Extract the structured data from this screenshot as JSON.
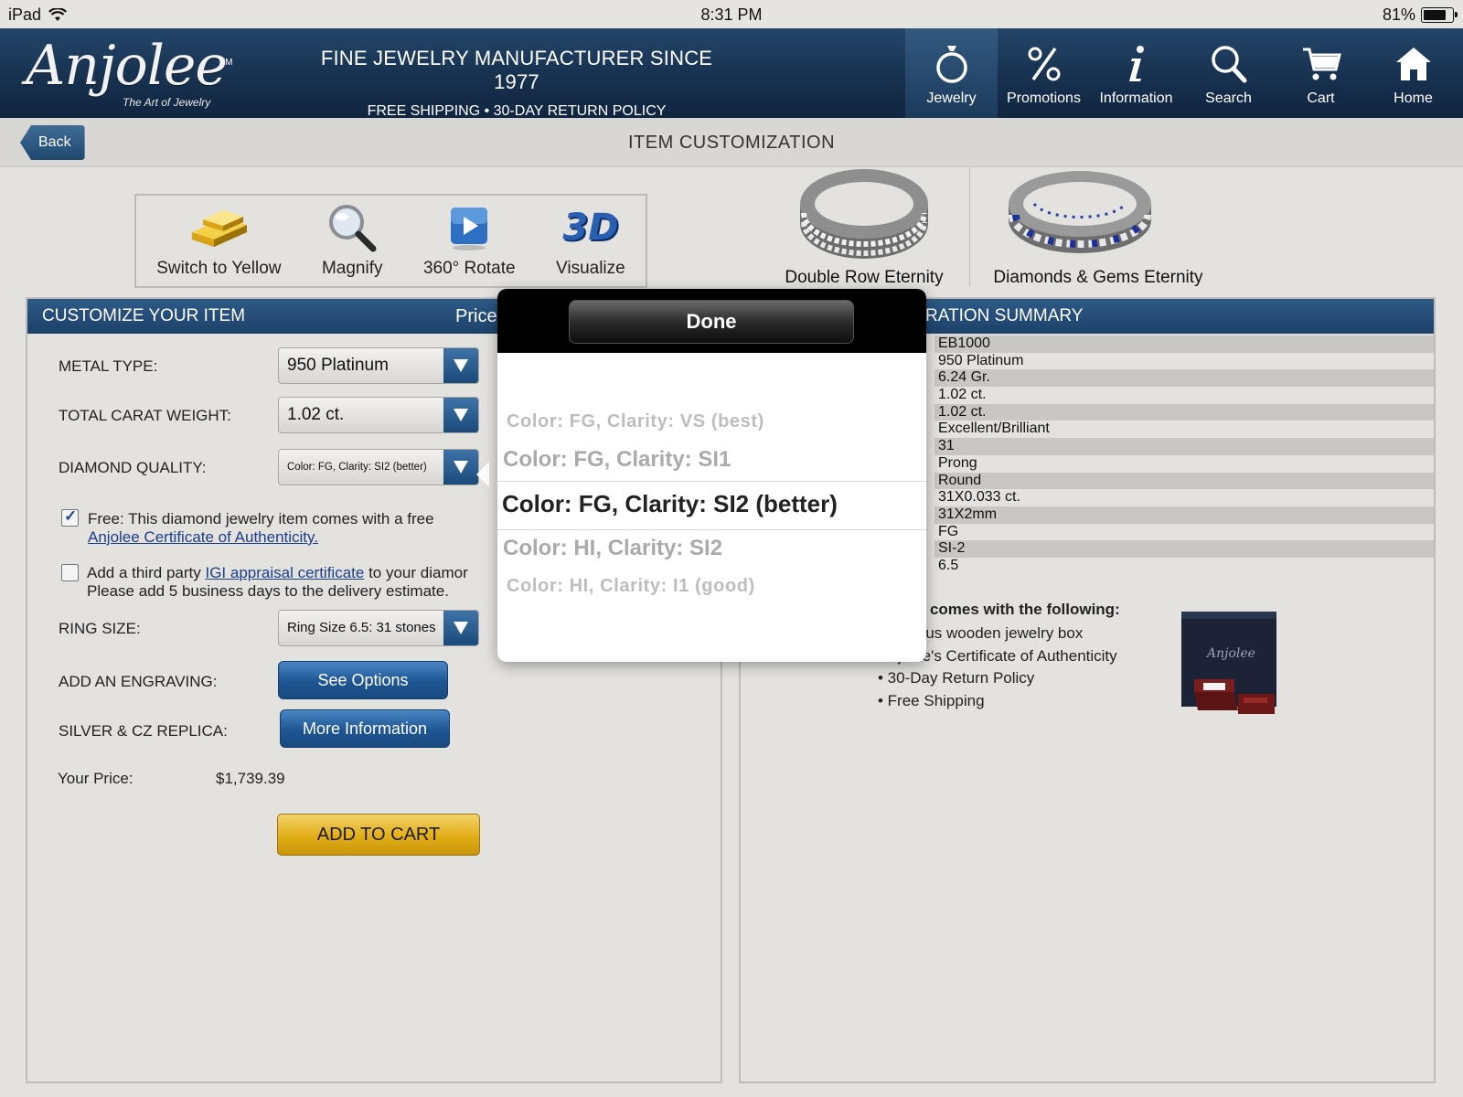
{
  "status": {
    "device": "iPad",
    "time": "8:31 PM",
    "battery": "81%",
    "battery_level": 0.81
  },
  "header": {
    "logo_text": "Anjolee",
    "logo_tm": "TM",
    "logo_tagline": "The Art of Jewelry",
    "tagline_main": "FINE JEWELRY MANUFACTURER SINCE 1977",
    "tagline_sub": "FREE SHIPPING  •  30-DAY RETURN POLICY",
    "nav": [
      {
        "label": "Jewelry",
        "icon": "ring-icon",
        "active": true
      },
      {
        "label": "Promotions",
        "icon": "percent-icon"
      },
      {
        "label": "Information",
        "icon": "info-icon"
      },
      {
        "label": "Search",
        "icon": "search-icon"
      },
      {
        "label": "Cart",
        "icon": "cart-icon"
      },
      {
        "label": "Home",
        "icon": "home-icon"
      }
    ]
  },
  "titlebar": {
    "back_label": "Back",
    "title": "ITEM CUSTOMIZATION"
  },
  "tools": [
    {
      "label": "Switch to Yellow",
      "icon": "gold-bars-icon"
    },
    {
      "label": "Magnify",
      "icon": "magnifier-icon"
    },
    {
      "label": "360° Rotate",
      "icon": "play-icon"
    },
    {
      "label": "Visualize",
      "icon": "3d-icon",
      "icon_text": "3D"
    }
  ],
  "thumbs": [
    {
      "label": "Double Row Eternity"
    },
    {
      "label": "Diamonds & Gems Eternity"
    }
  ],
  "customize": {
    "heading": "CUSTOMIZE YOUR ITEM",
    "price_label": "Price",
    "metal_label": "METAL TYPE:",
    "metal_value": "950 Platinum",
    "carat_label": "TOTAL CARAT WEIGHT:",
    "carat_value": "1.02 ct.",
    "quality_label": "DIAMOND QUALITY:",
    "quality_value": "Color: FG, Clarity: SI2 (better)",
    "cert_text": "Free: This diamond jewelry item comes with a free",
    "cert_link": "Anjolee Certificate of  Authenticity.",
    "igi_text_1": "Add a third party",
    "igi_link": "IGI appraisal certificate",
    "igi_text_2": " to your diamor",
    "igi_text_3": "Please add 5 business days to the delivery estimate.",
    "ring_label": "RING SIZE:",
    "ring_value": "Ring Size 6.5: 31 stones",
    "engraving_label": "ADD AN ENGRAVING:",
    "engraving_button": "See Options",
    "replica_label": "SILVER & CZ REPLICA:",
    "replica_button": "More Information",
    "your_price_label": "Your Price:",
    "your_price_value": "$1,739.39",
    "add_to_cart": "ADD TO CART"
  },
  "summary": {
    "heading": "RATION SUMMARY",
    "rows": [
      "EB1000",
      "950 Platinum",
      "6.24 Gr.",
      "1.02 ct.",
      "1.02 ct.",
      "Excellent/Brilliant",
      "31",
      "Prong",
      "Round",
      "31X0.033 ct.",
      "31X2mm",
      "FG",
      "SI-2",
      "6.5"
    ],
    "comes_title": "tem comes with the following:",
    "comes_items": [
      "urious wooden jewelry box",
      "...jolee's Certificate of Authenticity",
      "• 30-Day Return Policy",
      "• Free Shipping"
    ]
  },
  "picker": {
    "done_label": "Done",
    "options": [
      "Color: FG, Clarity: VS (best)",
      "Color: FG, Clarity: SI1",
      "Color: FG, Clarity: SI2 (better)",
      "Color: HI, Clarity: SI2",
      "Color: HI, Clarity: I1 (good)"
    ],
    "selected_index": 2
  }
}
